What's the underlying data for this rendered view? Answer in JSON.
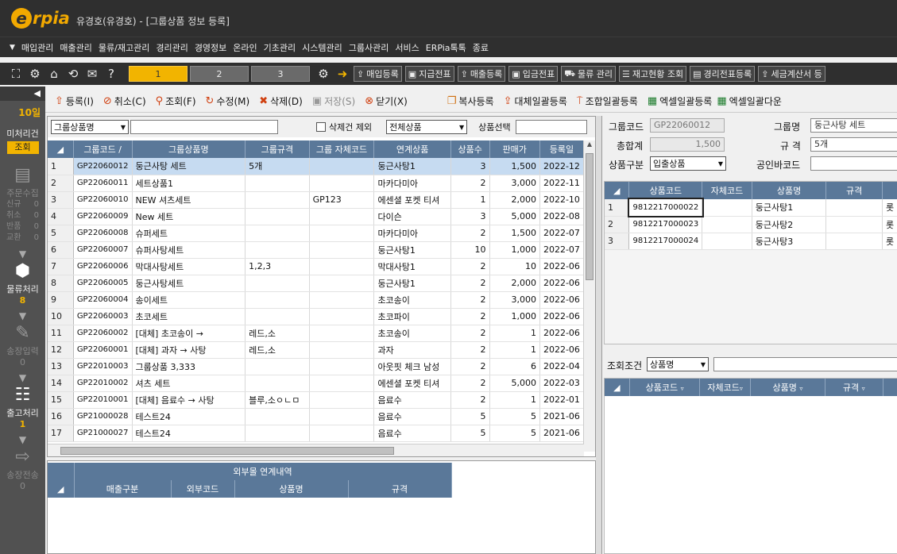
{
  "window": {
    "logo_letter": "e",
    "logo_rest": "rpia",
    "title": "유경호(유경호) - [그룹상품 정보 등록]"
  },
  "menu": [
    "매입관리",
    "매출관리",
    "물류/재고관리",
    "경리관리",
    "경영정보",
    "온라인",
    "기초관리",
    "시스템관리",
    "그룹사관리",
    "서비스",
    "ERPia톡톡",
    "종료"
  ],
  "toolbar": {
    "pages": [
      "1",
      "2",
      "3"
    ],
    "buttons": [
      {
        "label": "매입등록",
        "icon": "upload-icon"
      },
      {
        "label": "지급전표",
        "icon": "voucher-icon"
      },
      {
        "label": "매출등록",
        "icon": "upload-icon"
      },
      {
        "label": "입금전표",
        "icon": "voucher-icon"
      },
      {
        "label": "물류 관리",
        "icon": "cart-icon"
      },
      {
        "label": "재고현황 조회",
        "icon": "list-icon"
      },
      {
        "label": "경리전표등록",
        "icon": "document-icon"
      },
      {
        "label": "세금계산서 등",
        "icon": "tax-icon"
      }
    ]
  },
  "sidebar": {
    "day": "10일",
    "unprocessed_label": "미처리건",
    "query_button": "조회",
    "order_collect": "주문수집",
    "counts": [
      {
        "k": "신규",
        "v": "0"
      },
      {
        "k": "취소",
        "v": "0"
      },
      {
        "k": "반품",
        "v": "0"
      },
      {
        "k": "교환",
        "v": "0"
      }
    ],
    "logistics": "물류처리",
    "logistics_count": "8",
    "invoice_input": "송장입력",
    "invoice_count": "0",
    "shipping": "출고처리",
    "shipping_count": "1",
    "invoice_send": "송장전송",
    "invoice_send_count": "0"
  },
  "actions": [
    {
      "label": "등록(I)",
      "icon": "register-icon",
      "color": "#d04010"
    },
    {
      "label": "취소(C)",
      "icon": "cancel-icon",
      "color": "#d04010"
    },
    {
      "label": "조회(F)",
      "icon": "search-icon",
      "color": "#d04010"
    },
    {
      "label": "수정(M)",
      "icon": "edit-icon",
      "color": "#d04010"
    },
    {
      "label": "삭제(D)",
      "icon": "delete-icon",
      "color": "#d04010"
    },
    {
      "label": "저장(S)",
      "icon": "save-icon",
      "color": "#888888",
      "disabled": true
    },
    {
      "label": "닫기(X)",
      "icon": "close-icon",
      "color": "#d04010"
    },
    {
      "label": "복사등록",
      "icon": "copy-icon",
      "color": "#d07010"
    },
    {
      "label": "대체일괄등록",
      "icon": "upload-icon",
      "color": "#d04010"
    },
    {
      "label": "조합일괄등록",
      "icon": "combine-icon",
      "color": "#d04010"
    },
    {
      "label": "엑셀일괄등록",
      "icon": "excel-icon",
      "color": "#1a7a2a"
    },
    {
      "label": "엑셀일괄다운",
      "icon": "excel-icon",
      "color": "#1a7a2a"
    }
  ],
  "filter": {
    "field_select": "그룹상품명",
    "search_value": "",
    "exclude_deleted": "삭제건 제외",
    "product_scope": "전체상품",
    "product_select_label": "상품선택"
  },
  "group_grid": {
    "columns": [
      "그룹코드 /",
      "그룹상품명",
      "그룹규격",
      "그룹 자체코드",
      "연계상품",
      "상품수",
      "판매가",
      "등록일"
    ],
    "rows": [
      [
        "1",
        "GP22060012",
        "둥근사탕 세트",
        "5개",
        "",
        "둥근사탕1",
        "3",
        "1,500",
        "2022-12"
      ],
      [
        "2",
        "GP22060011",
        "세트상품1",
        "",
        "",
        "마카다미아",
        "2",
        "3,000",
        "2022-11"
      ],
      [
        "3",
        "GP22060010",
        "NEW 셔츠세트",
        "",
        "GP123",
        "에센셜 포켓 티셔",
        "1",
        "2,000",
        "2022-10"
      ],
      [
        "4",
        "GP22060009",
        "New 세트",
        "",
        "",
        "다이슨",
        "3",
        "5,000",
        "2022-08"
      ],
      [
        "5",
        "GP22060008",
        "슈퍼세트",
        "",
        "",
        "마카다미아",
        "2",
        "1,500",
        "2022-07"
      ],
      [
        "6",
        "GP22060007",
        "슈퍼사탕세트",
        "",
        "",
        "둥근사탕1",
        "10",
        "1,000",
        "2022-07"
      ],
      [
        "7",
        "GP22060006",
        "막대사탕세트",
        "1,2,3",
        "",
        "막대사탕1",
        "2",
        "10",
        "2022-06"
      ],
      [
        "8",
        "GP22060005",
        "둥근사탕세트",
        "",
        "",
        "둥근사탕1",
        "2",
        "2,000",
        "2022-06"
      ],
      [
        "9",
        "GP22060004",
        "송이세트",
        "",
        "",
        "초코송이",
        "2",
        "3,000",
        "2022-06"
      ],
      [
        "10",
        "GP22060003",
        "초코세트",
        "",
        "",
        "초코파이",
        "2",
        "1,000",
        "2022-06"
      ],
      [
        "11",
        "GP22060002",
        "[대체] 초코송이 →",
        "레드,소",
        "",
        "초코송이",
        "2",
        "1",
        "2022-06"
      ],
      [
        "12",
        "GP22060001",
        "[대체] 과자 → 사탕",
        "레드,소",
        "",
        "과자",
        "2",
        "1",
        "2022-06"
      ],
      [
        "13",
        "GP22010003",
        "그룹상품 3,333",
        "",
        "",
        "아웃핏 체크 남성",
        "2",
        "6",
        "2022-04"
      ],
      [
        "14",
        "GP22010002",
        "셔츠 세트",
        "",
        "",
        "에센셜 포켓 티셔",
        "2",
        "5,000",
        "2022-03"
      ],
      [
        "15",
        "GP22010001",
        "[대체] 음료수 → 사탕",
        "블루,소ㅇㄴㅁ",
        "",
        "음료수",
        "2",
        "1",
        "2022-01"
      ],
      [
        "16",
        "GP21000028",
        "테스트24",
        "",
        "",
        "음료수",
        "5",
        "5",
        "2021-06"
      ],
      [
        "17",
        "GP21000027",
        "테스트24",
        "",
        "",
        "음료수",
        "5",
        "5",
        "2021-06"
      ]
    ]
  },
  "external": {
    "title": "외부몰 연계내역",
    "columns": [
      "매출구분",
      "외부코드",
      "상품명",
      "규격"
    ]
  },
  "detail": {
    "group_code_label": "그룹코드",
    "group_code": "GP22060012",
    "group_name_label": "그룹명",
    "group_name": "둥근사탕 세트",
    "total_label": "총합계",
    "total": "1,500",
    "spec_label": "규 격",
    "spec": "5개",
    "type_label": "상품구분",
    "type": "입출상품",
    "barcode_label": "공인바코드",
    "barcode": ""
  },
  "items_grid": {
    "columns": [
      "상품코드",
      "자체코드",
      "상품명",
      "규격",
      ""
    ],
    "rows": [
      [
        "1",
        "9812217000022",
        "",
        "둥근사탕1",
        "",
        "롯"
      ],
      [
        "2",
        "9812217000023",
        "",
        "둥근사탕2",
        "",
        "롯"
      ],
      [
        "3",
        "9812217000024",
        "",
        "둥근사탕3",
        "",
        "롯"
      ]
    ]
  },
  "search_panel": {
    "condition_label": "조회조건",
    "condition": "상품명",
    "columns": [
      "상품코드",
      "자체코드",
      "상품명",
      "규격",
      ""
    ]
  }
}
